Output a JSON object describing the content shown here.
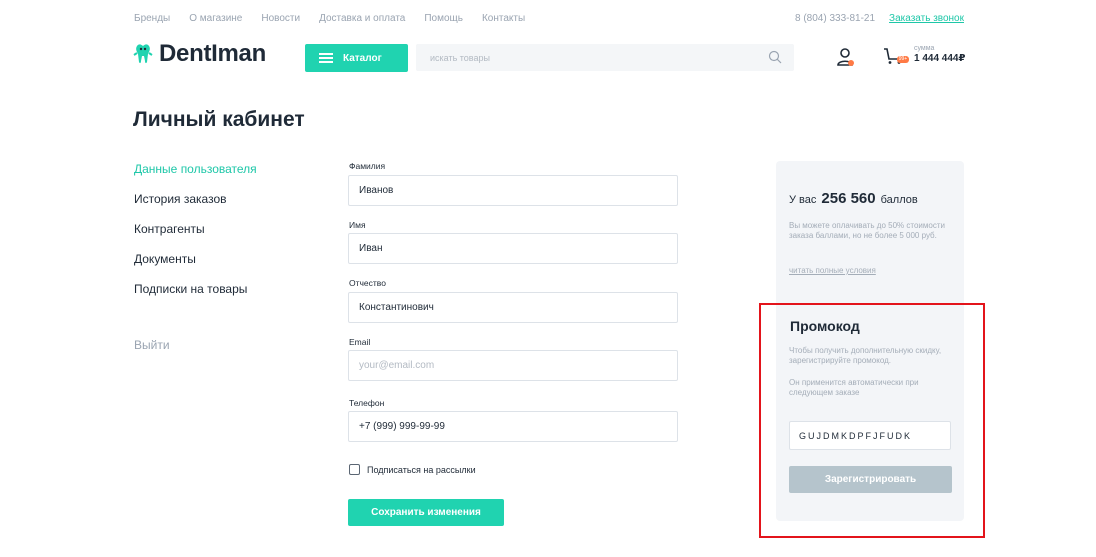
{
  "topnav": [
    "Бренды",
    "О магазине",
    "Новости",
    "Доставка и оплата",
    "Помощь",
    "Контакты"
  ],
  "header": {
    "phone": "8 (804) 333-81-21",
    "callback": "Заказать звонок",
    "logo_text": "DentIman",
    "catalog_label": "Каталог",
    "search_placeholder": "искать товары",
    "cart_badge": "99+",
    "sum_label": "сумма",
    "sum_value": "1 444 444₽"
  },
  "page_title": "Личный кабинет",
  "sidebar": {
    "items": [
      {
        "label": "Данные пользователя",
        "active": true
      },
      {
        "label": "История заказов"
      },
      {
        "label": "Контрагенты"
      },
      {
        "label": "Документы"
      },
      {
        "label": "Подписки на товары"
      }
    ],
    "logout": "Выйти"
  },
  "form": {
    "last_name": {
      "label": "Фамилия",
      "value": "Иванов"
    },
    "first_name": {
      "label": "Имя",
      "value": "Иван"
    },
    "patronymic": {
      "label": "Отчество",
      "value": "Константинович"
    },
    "email": {
      "label": "Email",
      "placeholder": "your@email.com"
    },
    "phone": {
      "label": "Телефон",
      "value": "+7 (999) 999-99-99"
    },
    "subscribe_label": "Подписаться на рассылки",
    "save_label": "Сохранить изменения"
  },
  "bonus": {
    "prefix": "У вас",
    "points": "256 560",
    "suffix": "баллов",
    "desc": "Вы можете оплачивать до 50% стоимости заказа баллами, но не более 5 000 руб.",
    "link": "читать полные условия"
  },
  "promo": {
    "title": "Промокод",
    "desc1": "Чтобы получить дополнительную скидку, зарегистрируйте промокод.",
    "desc2": "Он применится автоматически при следующем заказе",
    "code": "GUJDMKDPFJFUDK",
    "register_label": "Зарегистрировать"
  },
  "colors": {
    "accent": "#20d3b0",
    "highlight": "#e3141b",
    "disabled_button": "#b5c4cc"
  }
}
